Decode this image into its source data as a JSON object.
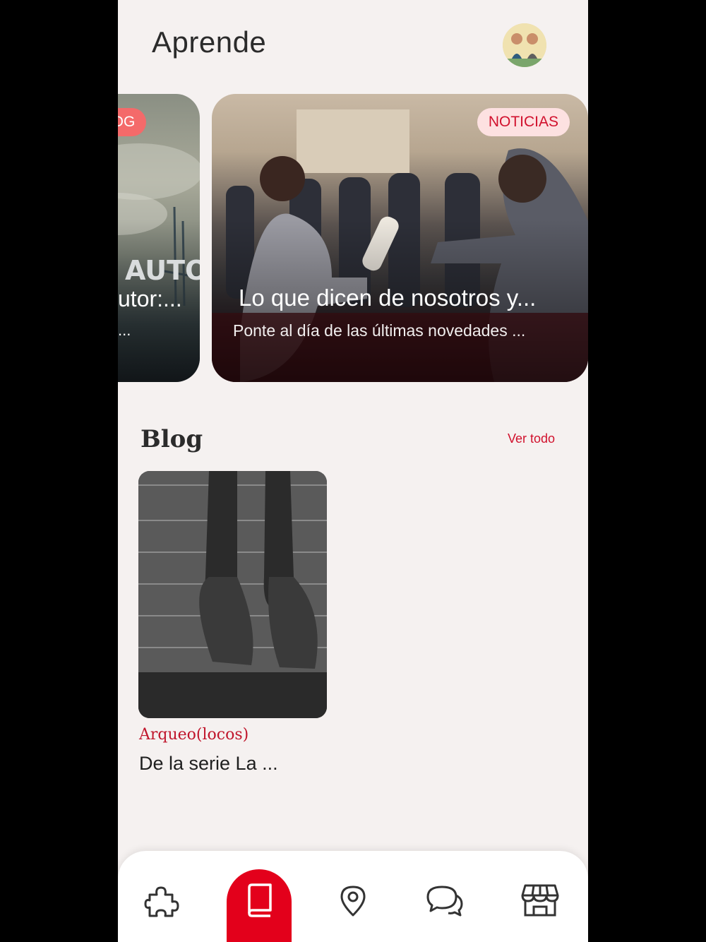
{
  "header": {
    "title": "Aprende"
  },
  "carousel": {
    "left_card": {
      "tag": "BLOG",
      "overlay_word": "AUTO",
      "title": "utor:...",
      "subtitle": "..."
    },
    "main_card": {
      "tag": "NOTICIAS",
      "title": "Lo que dicen de nosotros y...",
      "subtitle": "Ponte al día de las últimas novedades ..."
    }
  },
  "blog_section": {
    "title": "Blog",
    "see_all": "Ver todo",
    "items": [
      {
        "category": "Arqueo(locos)",
        "title": "De la serie La ..."
      }
    ]
  },
  "bottom_nav": {
    "items": [
      {
        "icon": "puzzle-icon",
        "active": false
      },
      {
        "icon": "book-icon",
        "active": true
      },
      {
        "icon": "location-pin-icon",
        "active": false
      },
      {
        "icon": "chat-icon",
        "active": false
      },
      {
        "icon": "store-icon",
        "active": false
      }
    ]
  },
  "colors": {
    "accent": "#e3001b",
    "tag_blog": "#f46a6a",
    "tag_noticias_bg": "#fde1e1",
    "background": "#f5f1f0"
  }
}
